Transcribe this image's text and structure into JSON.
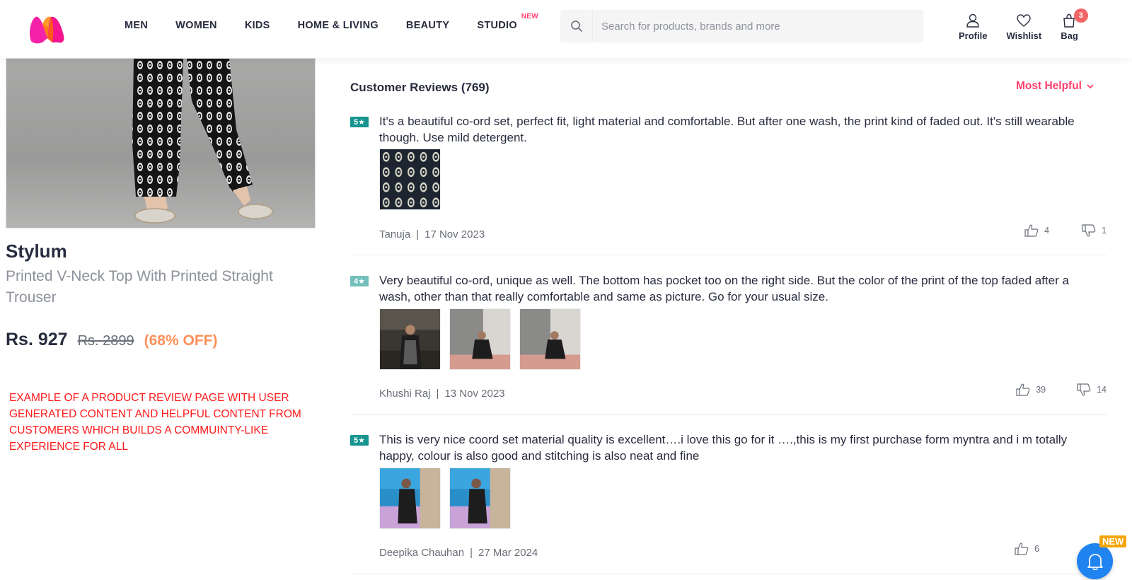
{
  "header": {
    "brand": "Myntra",
    "nav": [
      {
        "label": "MEN"
      },
      {
        "label": "WOMEN"
      },
      {
        "label": "KIDS"
      },
      {
        "label": "HOME & LIVING"
      },
      {
        "label": "BEAUTY"
      },
      {
        "label": "STUDIO",
        "tag": "NEW"
      }
    ],
    "search": {
      "placeholder": "Search for products, brands and more",
      "value": ""
    },
    "actions": {
      "profile": "Profile",
      "wishlist": "Wishlist",
      "bag": "Bag",
      "bag_count": "3"
    }
  },
  "product": {
    "brand": "Stylum",
    "name": "Printed V-Neck Top With Printed Straight Trouser",
    "price": "Rs. 927",
    "mrp": "Rs. 2899",
    "discount": "(68% OFF)",
    "image_alt": "Model wearing black and white printed straight trousers with embellished flats"
  },
  "annotation": "EXAMPLE OF A PRODUCT REVIEW PAGE WITH USER GENERATED CONTENT AND HELPFUL CONTENT FROM CUSTOMERS WHICH BUILDS A COMMUINTY-LIKE EXPERIENCE FOR ALL",
  "reviews": {
    "title": "Customer Reviews (769)",
    "sort_label": "Most Helpful",
    "items": [
      {
        "rating": "5★",
        "rating_color": "#14958f",
        "text": "It's a beautiful co-ord set, perfect fit, light material and comfortable. But after one wash, the print kind of faded out. It's still wearable though. Use mild detergent.",
        "photos": [
          "fabric-print-closeup"
        ],
        "author": "Tanuja",
        "date": "17 Nov 2023",
        "likes": "4",
        "dislikes": "1"
      },
      {
        "rating": "4★",
        "rating_color": "#72bfbc",
        "text": "Very beautiful co-ord, unique as well. The bottom has pocket too on the right side. But the color of the print of the top faded after a wash, other than that really comfortable and same as picture. Go for your usual size.",
        "photos": [
          "customer-photo-cafe",
          "customer-photo-sofa-1",
          "customer-photo-sofa-2"
        ],
        "author": "Khushi Raj",
        "date": "13 Nov 2023",
        "likes": "39",
        "dislikes": "14"
      },
      {
        "rating": "5★",
        "rating_color": "#14958f",
        "text": "This is very nice coord set material quality is excellent….i love this go for it ….,this is my first purchase form myntra and i m totally happy, colour is also good and stitching is also neat and fine",
        "photos": [
          "mirror-selfie-1",
          "mirror-selfie-2"
        ],
        "author": "Deepika Chauhan",
        "date": "27 Mar 2024",
        "likes": "6",
        "dislikes": ""
      }
    ]
  },
  "notification": {
    "badge": "NEW"
  }
}
